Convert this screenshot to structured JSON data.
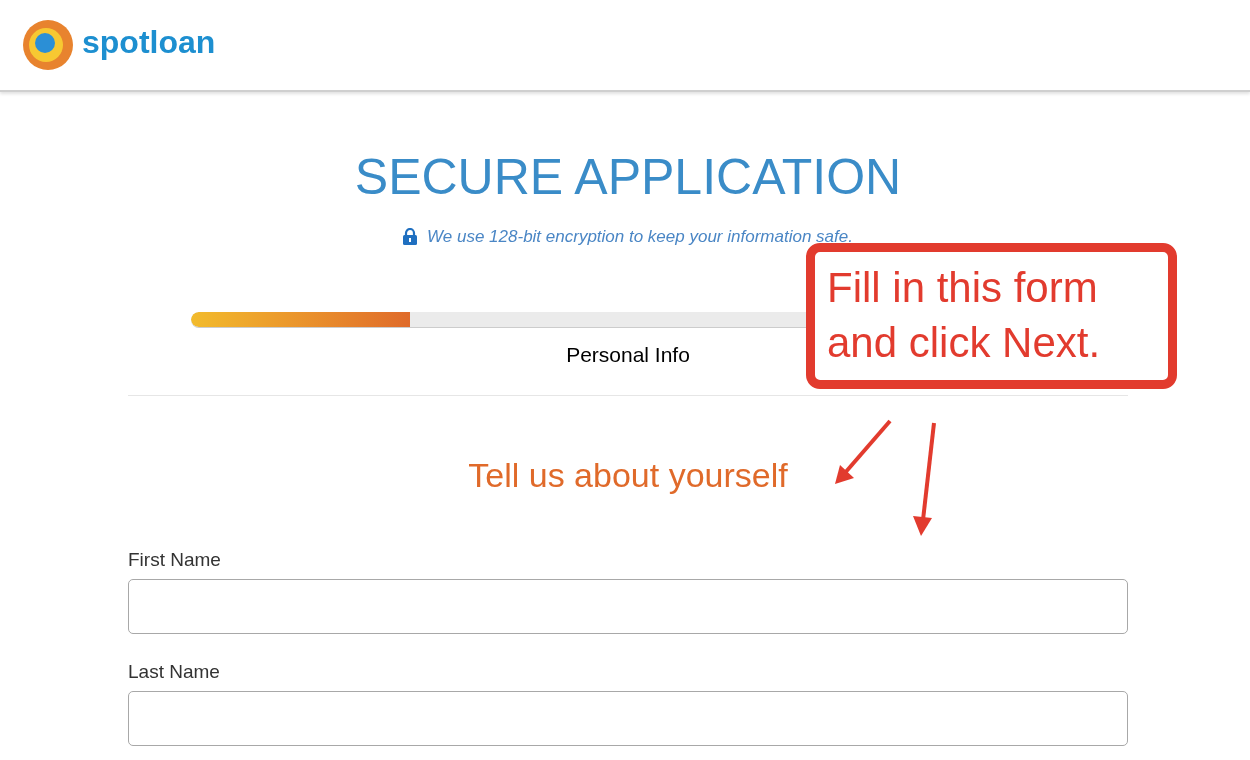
{
  "header": {
    "logo_text": "spotloan"
  },
  "title": "SECURE APPLICATION",
  "security_note": "We use 128-bit encryption to keep your information safe.",
  "progress": {
    "level": 0.25,
    "label": "Personal Info"
  },
  "section_heading": "Tell us about yourself",
  "fields": [
    {
      "label": "First Name"
    },
    {
      "label": "Last Name"
    }
  ],
  "annotation": {
    "text": "Fill in this form and click Next."
  }
}
